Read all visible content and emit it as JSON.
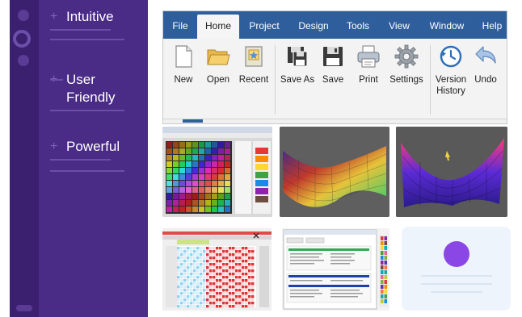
{
  "promo": {
    "features": [
      {
        "lines": [
          "Intuitive"
        ]
      },
      {
        "lines": [
          "User",
          "Friendly"
        ]
      },
      {
        "lines": [
          "Powerful"
        ]
      }
    ]
  },
  "menubar": {
    "items": [
      {
        "label": "File",
        "active": false
      },
      {
        "label": "Home",
        "active": true
      },
      {
        "label": "Project",
        "active": false
      },
      {
        "label": "Design",
        "active": false
      },
      {
        "label": "Tools",
        "active": false
      },
      {
        "label": "View",
        "active": false
      },
      {
        "label": "Window",
        "active": false
      },
      {
        "label": "Help",
        "active": false
      }
    ]
  },
  "ribbon": {
    "tools": [
      {
        "label": "New",
        "icon": "new-document-icon"
      },
      {
        "label": "Open",
        "icon": "open-folder-icon"
      },
      {
        "label": "Recent",
        "icon": "recent-star-icon"
      },
      {
        "label": "Save As",
        "icon": "save-as-icon"
      },
      {
        "label": "Save",
        "icon": "save-icon"
      },
      {
        "label": "Print",
        "icon": "printer-icon"
      },
      {
        "label": "Settings",
        "icon": "gear-icon"
      },
      {
        "label": "Version",
        "label2": "History",
        "icon": "version-history-icon"
      },
      {
        "label": "Undo",
        "icon": "undo-icon"
      }
    ]
  },
  "colors": {
    "promo_bg": "#4a2b86",
    "menubar_bg": "#2f5e9c",
    "placeholder_accent": "#8b47e6"
  },
  "gallery": {
    "thumbnails": [
      "grid-pattern-editor",
      "3d-surface-plot",
      "3d-surface-plot-dark",
      "weave-pattern",
      "settings-dialog",
      "placeholder-card"
    ]
  }
}
